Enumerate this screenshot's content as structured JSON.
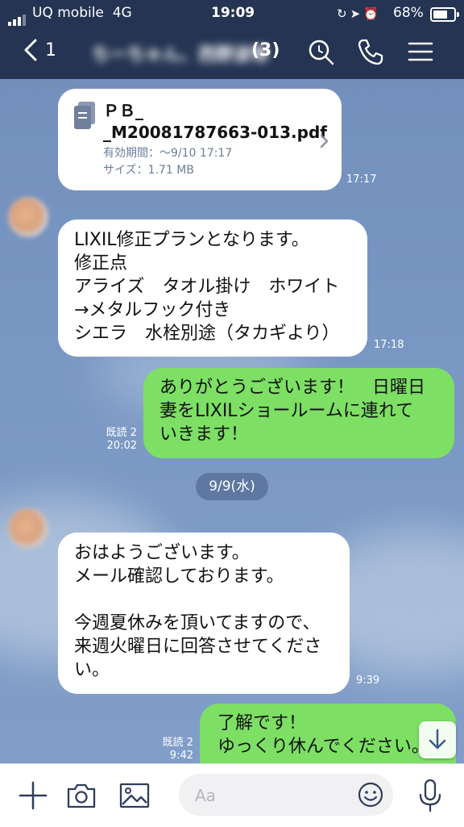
{
  "status_bar": {
    "carrier": "UQ mobile",
    "network": "4G",
    "time": "19:09",
    "battery": "68%",
    "battery_level": 0.68
  },
  "header": {
    "back_count": "1",
    "chat_name": "　ちーちゃん、西野波等",
    "member_count": "(3)",
    "icons": [
      "back-chevron-icon",
      "search-icon",
      "phone-icon",
      "menu-icon"
    ]
  },
  "messages": {
    "file": {
      "name_line1": "ＰＢ_　　　　",
      "name_line2": "_M20081787663-013.pdf",
      "expiry": "有効期間：〜9/10 17:17",
      "size": "サイズ：1.71 MB",
      "time": "17:17"
    },
    "m1": {
      "sender": "　　　　　",
      "text": "LIXIL修正プランとなります。\n修正点\nアライズ　タオル掛け　ホワイト\n→メタルフック付き\nシエラ　水栓別途（タカギより）",
      "time": "17:18"
    },
    "m2": {
      "text": "ありがとうございます！　日曜日\n妻をLIXILショールームに連れて\nいきます！",
      "read": "既読 2",
      "time": "20:02"
    },
    "date_divider": "9/9(水)",
    "m3": {
      "sender": "　　　　　",
      "text": "おはようございます。\nメール確認しております。\n\n今週夏休みを頂いてますので、\n来週火曜日に回答させてくださ\nい。",
      "time": "9:39"
    },
    "m4": {
      "text": "了解です！\nゆっくり休んでください。",
      "read": "既読 2",
      "time": "9:42"
    }
  },
  "input_bar": {
    "placeholder": "Aa",
    "icons": [
      "plus-icon",
      "camera-icon",
      "image-icon",
      "emoji-icon",
      "microphone-icon"
    ]
  },
  "colors": {
    "header_bg": "#243452",
    "chat_bg": "#7390bd",
    "outgoing_bubble": "#7ddf64",
    "incoming_bubble": "#ffffff"
  }
}
